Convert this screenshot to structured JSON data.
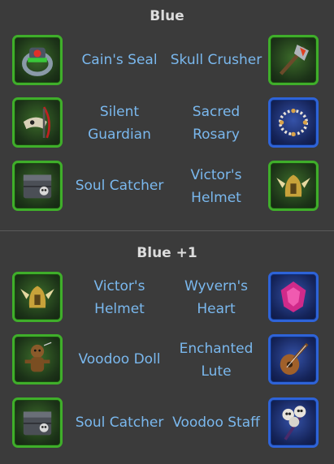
{
  "sections": [
    {
      "title": "Blue",
      "rows": [
        {
          "left": {
            "name": "Cain's Seal",
            "icon": "ring-icon",
            "rarity": "green"
          },
          "right": {
            "name": "Skull Crusher",
            "icon": "skull-crusher-axe-icon",
            "rarity": "green"
          }
        },
        {
          "left": {
            "name": "Silent Guardian",
            "line1": "Silent",
            "line2": "Guardian",
            "icon": "bird-skull-staff-icon",
            "rarity": "green"
          },
          "right": {
            "name": "Sacred Rosary",
            "line1": "Sacred",
            "line2": "Rosary",
            "icon": "rosary-icon",
            "rarity": "blue"
          }
        },
        {
          "left": {
            "name": "Soul Catcher",
            "icon": "soul-catcher-chest-icon",
            "rarity": "green"
          },
          "right": {
            "name": "Victor's Helmet",
            "line1": "Victor's",
            "line2": "Helmet",
            "icon": "winged-helmet-icon",
            "rarity": "green"
          }
        }
      ]
    },
    {
      "title": "Blue +1",
      "rows": [
        {
          "left": {
            "name": "Victor's Helmet",
            "line1": "Victor's",
            "line2": "Helmet",
            "icon": "winged-helmet-icon",
            "rarity": "green"
          },
          "right": {
            "name": "Wyvern's Heart",
            "line1": "Wyvern's",
            "line2": "Heart",
            "icon": "gem-heart-icon",
            "rarity": "blue"
          }
        },
        {
          "left": {
            "name": "Voodoo Doll",
            "icon": "voodoo-doll-icon",
            "rarity": "green"
          },
          "right": {
            "name": "Enchanted Lute",
            "line1": "Enchanted",
            "line2": "Lute",
            "icon": "lute-icon",
            "rarity": "blue"
          }
        },
        {
          "left": {
            "name": "Soul Catcher",
            "icon": "soul-catcher-chest-icon",
            "rarity": "green"
          },
          "right": {
            "name": "Voodoo Staff",
            "icon": "skull-staff-icon",
            "rarity": "blue"
          }
        }
      ]
    }
  ],
  "colors": {
    "background": "#3b3b3b",
    "label": "#7ab8ee",
    "green_frame": "#3fae2a",
    "blue_frame": "#2e63d8"
  }
}
